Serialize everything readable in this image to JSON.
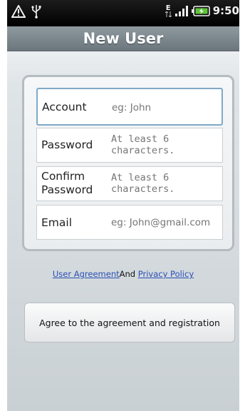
{
  "status_bar": {
    "time": "9:50",
    "network_type": "E",
    "icons": [
      "alert-icon",
      "usb-icon",
      "network-data-icon",
      "signal-icon",
      "battery-icon"
    ]
  },
  "title_bar": {
    "title": "New User"
  },
  "form": {
    "fields": [
      {
        "label": "Account",
        "placeholder": "eg: John"
      },
      {
        "label": "Password",
        "placeholder": "At least 6 characters."
      },
      {
        "label": "Confirm Password",
        "placeholder": "At least 6 characters."
      },
      {
        "label": "Email",
        "placeholder": "eg: John@gmail.com"
      }
    ]
  },
  "links": {
    "user_agreement": "User Agreement",
    "and_text": "And",
    "privacy_policy": "Privacy Policy"
  },
  "agree_button": {
    "label": "Agree to the agreement and registration"
  },
  "colors": {
    "title_bar": "#7c878c",
    "link": "#2b4fb5",
    "active_border": "#80a9c7",
    "status_bar": "#000000"
  }
}
